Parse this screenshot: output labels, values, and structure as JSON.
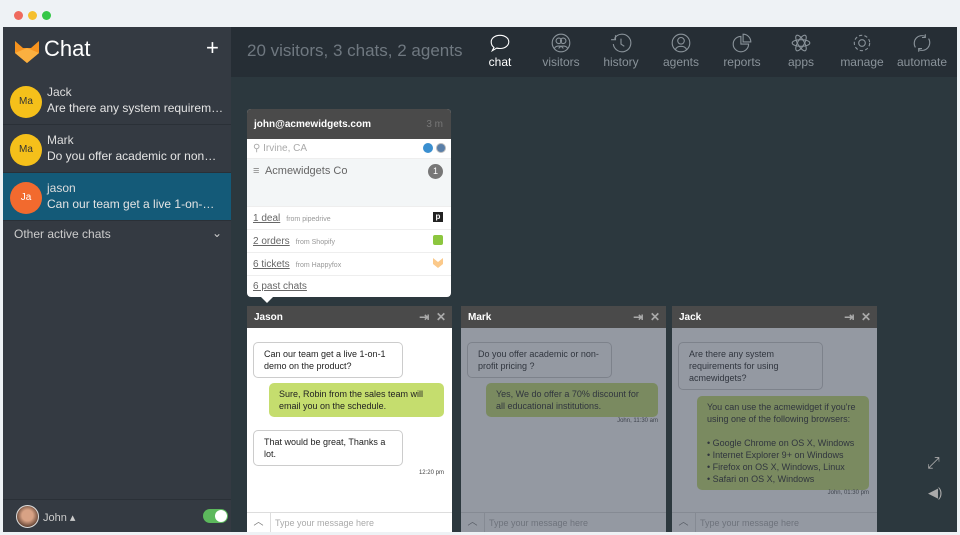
{
  "colors": {
    "accent": "#145a78",
    "sidebar": "#343a42",
    "agent_bubble": "#c5dd6e",
    "toggle": "#5cb85c"
  },
  "app": {
    "title": "Chat",
    "new_chat": "+"
  },
  "sidebar": {
    "chats": [
      {
        "initials": "Ma",
        "name": "Jack",
        "message": "Are there any system requirem…",
        "avatar_color": "#f5c01a"
      },
      {
        "initials": "Ma",
        "name": "Mark",
        "message": "Do you offer academic or non…",
        "avatar_color": "#f5c01a"
      },
      {
        "initials": "Ja",
        "name": "jason",
        "message": "Can our team get a live 1-on-…",
        "avatar_color": "#f26a2e",
        "active": true
      }
    ],
    "other_label": "Other active chats",
    "user": "John",
    "status_on": true
  },
  "header": {
    "stats": "20 visitors, 3 chats, 2 agents",
    "nav": [
      {
        "label": "chat",
        "icon": "speech-bubble-icon"
      },
      {
        "label": "visitors",
        "icon": "visitors-icon"
      },
      {
        "label": "history",
        "icon": "clock-icon"
      },
      {
        "label": "agents",
        "icon": "agent-icon"
      },
      {
        "label": "reports",
        "icon": "pie-chart-icon"
      },
      {
        "label": "apps",
        "icon": "atom-icon"
      },
      {
        "label": "manage",
        "icon": "gear-icon"
      },
      {
        "label": "automate",
        "icon": "refresh-icon"
      }
    ]
  },
  "visitor": {
    "email": "john@acmewidgets.com",
    "time": "3 m",
    "location": "Irvine, CA",
    "company": "Acmewidgets Co",
    "company_count": "1",
    "integrations": [
      {
        "link": "1 deal",
        "source": "from pipedrive"
      },
      {
        "link": "2 orders",
        "source": "from Shopify"
      },
      {
        "link": "6 tickets",
        "source": "from Happyfox"
      }
    ],
    "past_chats": "6 past chats"
  },
  "windows": [
    {
      "name": "Jason",
      "messages": [
        {
          "dir": "in",
          "text": "Can our team get a live 1-on-1 demo on the product?"
        },
        {
          "dir": "out",
          "text": "Sure, Robin from the sales team will email you on the schedule."
        },
        {
          "dir": "in",
          "text": "That would be great, Thanks a lot."
        }
      ],
      "time": "12:20 pm"
    },
    {
      "name": "Mark",
      "messages": [
        {
          "dir": "in",
          "text": "Do you offer academic or non-profit pricing ?"
        },
        {
          "dir": "out",
          "text": "Yes, We do offer a 70% discount for all educational institutions."
        }
      ],
      "time": "John, 11:30 am"
    },
    {
      "name": "Jack",
      "messages": [
        {
          "dir": "in",
          "text": "Are there any system requirements for using acmewidgets?"
        },
        {
          "dir": "out",
          "text": "You can use the acmewidget if you're using one of the following browsers:",
          "list": [
            "• Google Chrome on OS X, Windows",
            "• Internet Explorer 9+ on Windows",
            "• Firefox on OS X, Windows, Linux",
            "• Safari on OS X, Windows"
          ]
        }
      ],
      "time": "John, 01:30 pm"
    }
  ],
  "input_placeholder": "Type your message here"
}
